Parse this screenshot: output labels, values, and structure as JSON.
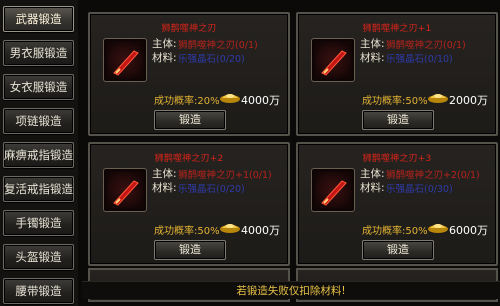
{
  "sidebar": {
    "items": [
      {
        "label": "武器锻造",
        "active": true
      },
      {
        "label": "男衣服锻造",
        "active": false
      },
      {
        "label": "女衣服锻造",
        "active": false
      },
      {
        "label": "项链锻造",
        "active": false
      },
      {
        "label": "麻痹戒指锻造",
        "active": false
      },
      {
        "label": "复活戒指锻造",
        "active": false
      },
      {
        "label": "手镯锻造",
        "active": false
      },
      {
        "label": "头盔锻造",
        "active": false
      },
      {
        "label": "腰带锻造",
        "active": false
      }
    ]
  },
  "cards": [
    {
      "title": "狮鹊噬神之刃",
      "main_label": "主体:",
      "main_value": "狮鹊噬神之刃(0/1)",
      "material_label": "材料:",
      "material_value": "乐强晶石(0/20)",
      "rate": "成功概率:20%",
      "cost": "4000万",
      "button": "锻造"
    },
    {
      "title": "狮鹊噬神之刃+1",
      "main_label": "主体:",
      "main_value": "狮鹊噬神之刃(0/1)",
      "material_label": "材料:",
      "material_value": "乐强晶石(0/10)",
      "rate": "成功概率:50%",
      "cost": "2000万",
      "button": "锻造"
    },
    {
      "title": "狮鹊噬神之刃+2",
      "main_label": "主体:",
      "main_value": "狮鹊噬神之刃+1(0/1)",
      "material_label": "材料:",
      "material_value": "乐强晶石(0/20)",
      "rate": "成功概率:50%",
      "cost": "4000万",
      "button": "锻造"
    },
    {
      "title": "狮鹊噬神之刃+3",
      "main_label": "主体:",
      "main_value": "狮鹊噬神之刃+2(0/1)",
      "material_label": "材料:",
      "material_value": "乐强晶石(0/30)",
      "rate": "成功概率:50%",
      "cost": "6000万",
      "button": "锻造"
    }
  ],
  "notice": "若锻造失败仅扣除材料!",
  "icons": {
    "item": "red-blade-icon",
    "currency": "gold-ingot-icon"
  },
  "colors": {
    "title": "#d8241a",
    "rate": "#e2b233",
    "notice": "#e8c347"
  }
}
